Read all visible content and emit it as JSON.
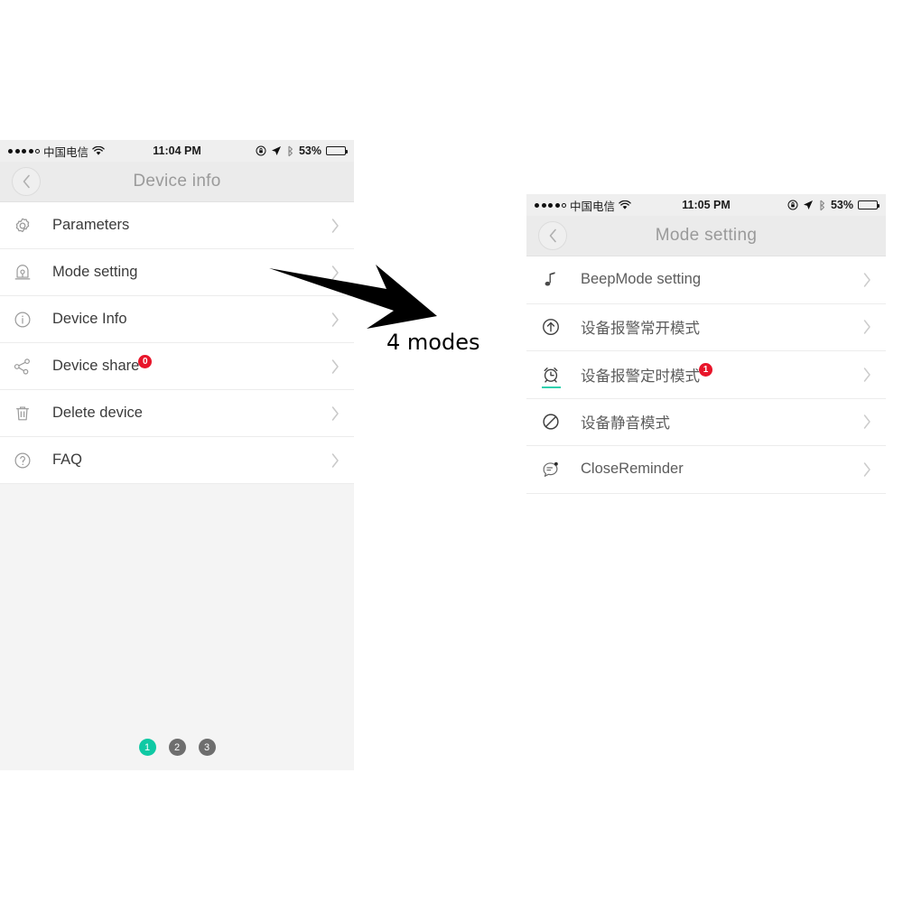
{
  "annotation": {
    "caption": "4 modes",
    "arrow_icon": "thick-right-arrow-icon"
  },
  "phone_left": {
    "status_bar": {
      "signal_icon": "signal-dots-icon",
      "carrier": "中国电信",
      "wifi_icon": "wifi-icon",
      "time": "11:04 PM",
      "rotation_lock_icon": "rotation-lock-icon",
      "location_icon": "location-arrow-icon",
      "bluetooth_icon": "bluetooth-icon",
      "battery_percent": "53%",
      "battery_icon": "battery-icon"
    },
    "nav": {
      "back_icon": "chevron-left-icon",
      "title": "Device info"
    },
    "rows": [
      {
        "icon": "gear-icon",
        "label": "Parameters",
        "badge": null,
        "chevron": "chevron-right-icon"
      },
      {
        "icon": "alarm-device-icon",
        "label": "Mode setting",
        "badge": null,
        "chevron": "chevron-right-icon"
      },
      {
        "icon": "info-circle-icon",
        "label": "Device Info",
        "badge": null,
        "chevron": "chevron-right-icon"
      },
      {
        "icon": "share-icon",
        "label": "Device share",
        "badge": "0",
        "chevron": "chevron-right-icon"
      },
      {
        "icon": "trash-icon",
        "label": "Delete device",
        "badge": null,
        "chevron": "chevron-right-icon"
      },
      {
        "icon": "question-circle-icon",
        "label": "FAQ",
        "badge": null,
        "chevron": "chevron-right-icon"
      }
    ],
    "pager": {
      "dots": [
        {
          "label": "1",
          "state": "active"
        },
        {
          "label": "2",
          "state": "idle"
        },
        {
          "label": "3",
          "state": "idle"
        }
      ],
      "active_color": "#0fc9a4",
      "idle_color": "#6e6e6e"
    }
  },
  "phone_right": {
    "status_bar": {
      "signal_icon": "signal-dots-icon",
      "carrier": "中国电信",
      "wifi_icon": "wifi-icon",
      "time": "11:05 PM",
      "rotation_lock_icon": "rotation-lock-icon",
      "location_icon": "location-arrow-icon",
      "bluetooth_icon": "bluetooth-icon",
      "battery_percent": "53%",
      "battery_icon": "battery-icon"
    },
    "nav": {
      "back_icon": "chevron-left-icon",
      "title": "Mode setting"
    },
    "rows": [
      {
        "icon": "music-note-icon",
        "label": "BeepMode setting",
        "badge": null,
        "selected": false,
        "chevron": "chevron-right-icon"
      },
      {
        "icon": "arrow-up-circle-icon",
        "label": "设备报警常开模式",
        "badge": null,
        "selected": false,
        "chevron": "chevron-right-icon"
      },
      {
        "icon": "alarm-clock-icon",
        "label": "设备报警定时模式",
        "badge": "1",
        "selected": true,
        "chevron": "chevron-right-icon"
      },
      {
        "icon": "prohibited-icon",
        "label": "设备静音模式",
        "badge": null,
        "selected": false,
        "chevron": "chevron-right-icon"
      },
      {
        "icon": "chat-bubble-icon",
        "label": "CloseReminder",
        "badge": null,
        "selected": false,
        "chevron": "chevron-right-icon"
      }
    ],
    "selected_marker_color": "#2fd0ae"
  },
  "badge_color": "#e8152a"
}
